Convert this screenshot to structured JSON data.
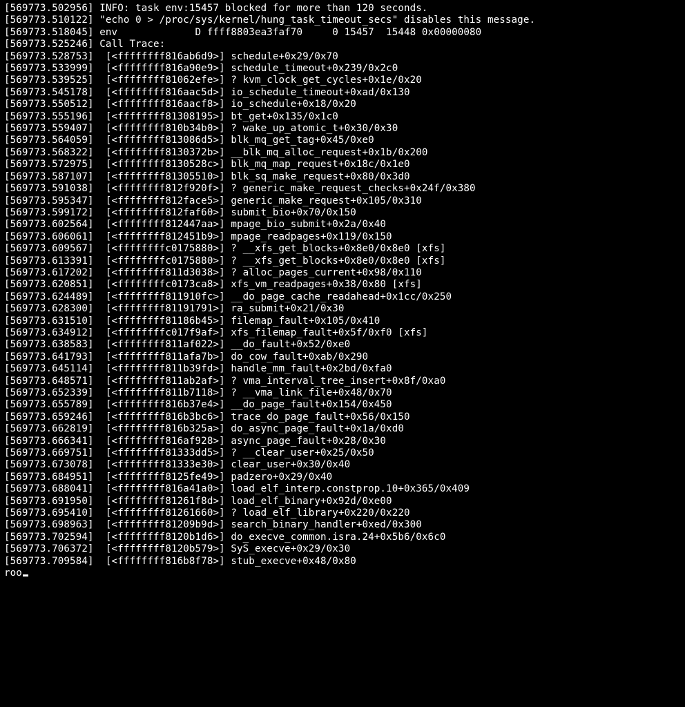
{
  "header_lines": [
    "[569773.502956] INFO: task env:15457 blocked for more than 120 seconds.",
    "[569773.510122] \"echo 0 > /proc/sys/kernel/hung_task_timeout_secs\" disables this message.",
    "[569773.518045] env             D ffff8803ea3faf70     0 15457  15448 0x00000080",
    "[569773.525246] Call Trace:"
  ],
  "trace": [
    {
      "ts": "569773.528753",
      "addr": "ffffffff816ab6d9",
      "sym": "schedule+0x29/0x70"
    },
    {
      "ts": "569773.533999",
      "addr": "ffffffff816a90e9",
      "sym": "schedule_timeout+0x239/0x2c0"
    },
    {
      "ts": "569773.539525",
      "addr": "ffffffff81062efe",
      "sym": "? kvm_clock_get_cycles+0x1e/0x20"
    },
    {
      "ts": "569773.545178",
      "addr": "ffffffff816aac5d",
      "sym": "io_schedule_timeout+0xad/0x130"
    },
    {
      "ts": "569773.550512",
      "addr": "ffffffff816aacf8",
      "sym": "io_schedule+0x18/0x20"
    },
    {
      "ts": "569773.555196",
      "addr": "ffffffff81308195",
      "sym": "bt_get+0x135/0x1c0"
    },
    {
      "ts": "569773.559407",
      "addr": "ffffffff810b34b0",
      "sym": "? wake_up_atomic_t+0x30/0x30"
    },
    {
      "ts": "569773.564059",
      "addr": "ffffffff813086d5",
      "sym": "blk_mq_get_tag+0x45/0xe0"
    },
    {
      "ts": "569773.568322",
      "addr": "ffffffff8130372b",
      "sym": "__blk_mq_alloc_request+0x1b/0x200"
    },
    {
      "ts": "569773.572975",
      "addr": "ffffffff8130528c",
      "sym": "blk_mq_map_request+0x18c/0x1e0"
    },
    {
      "ts": "569773.587107",
      "addr": "ffffffff81305510",
      "sym": "blk_sq_make_request+0x80/0x3d0"
    },
    {
      "ts": "569773.591038",
      "addr": "ffffffff812f920f",
      "sym": "? generic_make_request_checks+0x24f/0x380"
    },
    {
      "ts": "569773.595347",
      "addr": "ffffffff812face5",
      "sym": "generic_make_request+0x105/0x310"
    },
    {
      "ts": "569773.599172",
      "addr": "ffffffff812faf60",
      "sym": "submit_bio+0x70/0x150"
    },
    {
      "ts": "569773.602564",
      "addr": "ffffffff812447aa",
      "sym": "mpage_bio_submit+0x2a/0x40"
    },
    {
      "ts": "569773.606061",
      "addr": "ffffffff812451b9",
      "sym": "mpage_readpages+0x119/0x150"
    },
    {
      "ts": "569773.609567",
      "addr": "ffffffffc0175880",
      "sym": "? __xfs_get_blocks+0x8e0/0x8e0 [xfs]"
    },
    {
      "ts": "569773.613391",
      "addr": "ffffffffc0175880",
      "sym": "? __xfs_get_blocks+0x8e0/0x8e0 [xfs]"
    },
    {
      "ts": "569773.617202",
      "addr": "ffffffff811d3038",
      "sym": "? alloc_pages_current+0x98/0x110"
    },
    {
      "ts": "569773.620851",
      "addr": "ffffffffc0173ca8",
      "sym": "xfs_vm_readpages+0x38/0x80 [xfs]"
    },
    {
      "ts": "569773.624489",
      "addr": "ffffffff811910fc",
      "sym": "__do_page_cache_readahead+0x1cc/0x250"
    },
    {
      "ts": "569773.628300",
      "addr": "ffffffff81191791",
      "sym": "ra_submit+0x21/0x30"
    },
    {
      "ts": "569773.631510",
      "addr": "ffffffff81186b45",
      "sym": "filemap_fault+0x105/0x410"
    },
    {
      "ts": "569773.634912",
      "addr": "ffffffffc017f9af",
      "sym": "xfs_filemap_fault+0x5f/0xf0 [xfs]"
    },
    {
      "ts": "569773.638583",
      "addr": "ffffffff811af022",
      "sym": "__do_fault+0x52/0xe0"
    },
    {
      "ts": "569773.641793",
      "addr": "ffffffff811afa7b",
      "sym": "do_cow_fault+0xab/0x290"
    },
    {
      "ts": "569773.645114",
      "addr": "ffffffff811b39fd",
      "sym": "handle_mm_fault+0x2bd/0xfa0"
    },
    {
      "ts": "569773.648571",
      "addr": "ffffffff811ab2af",
      "sym": "? vma_interval_tree_insert+0x8f/0xa0"
    },
    {
      "ts": "569773.652339",
      "addr": "ffffffff811b7118",
      "sym": "? __vma_link_file+0x48/0x70"
    },
    {
      "ts": "569773.655789",
      "addr": "ffffffff816b37e4",
      "sym": "__do_page_fault+0x154/0x450"
    },
    {
      "ts": "569773.659246",
      "addr": "ffffffff816b3bc6",
      "sym": "trace_do_page_fault+0x56/0x150"
    },
    {
      "ts": "569773.662819",
      "addr": "ffffffff816b325a",
      "sym": "do_async_page_fault+0x1a/0xd0"
    },
    {
      "ts": "569773.666341",
      "addr": "ffffffff816af928",
      "sym": "async_page_fault+0x28/0x30"
    },
    {
      "ts": "569773.669751",
      "addr": "ffffffff81333dd5",
      "sym": "? __clear_user+0x25/0x50"
    },
    {
      "ts": "569773.673078",
      "addr": "ffffffff81333e30",
      "sym": "clear_user+0x30/0x40"
    },
    {
      "ts": "569773.684951",
      "addr": "ffffffff8125fe49",
      "sym": "padzero+0x29/0x40"
    },
    {
      "ts": "569773.688041",
      "addr": "ffffffff816a41a0",
      "sym": "load_elf_interp.constprop.10+0x365/0x409"
    },
    {
      "ts": "569773.691950",
      "addr": "ffffffff81261f8d",
      "sym": "load_elf_binary+0x92d/0xe00"
    },
    {
      "ts": "569773.695410",
      "addr": "ffffffff81261660",
      "sym": "? load_elf_library+0x220/0x220"
    },
    {
      "ts": "569773.698963",
      "addr": "ffffffff81209b9d",
      "sym": "search_binary_handler+0xed/0x300"
    },
    {
      "ts": "569773.702594",
      "addr": "ffffffff8120b1d6",
      "sym": "do_execve_common.isra.24+0x5b6/0x6c0"
    },
    {
      "ts": "569773.706372",
      "addr": "ffffffff8120b579",
      "sym": "SyS_execve+0x29/0x30"
    },
    {
      "ts": "569773.709584",
      "addr": "ffffffff816b8f78",
      "sym": "stub_execve+0x48/0x80"
    }
  ],
  "prompt": "roo"
}
